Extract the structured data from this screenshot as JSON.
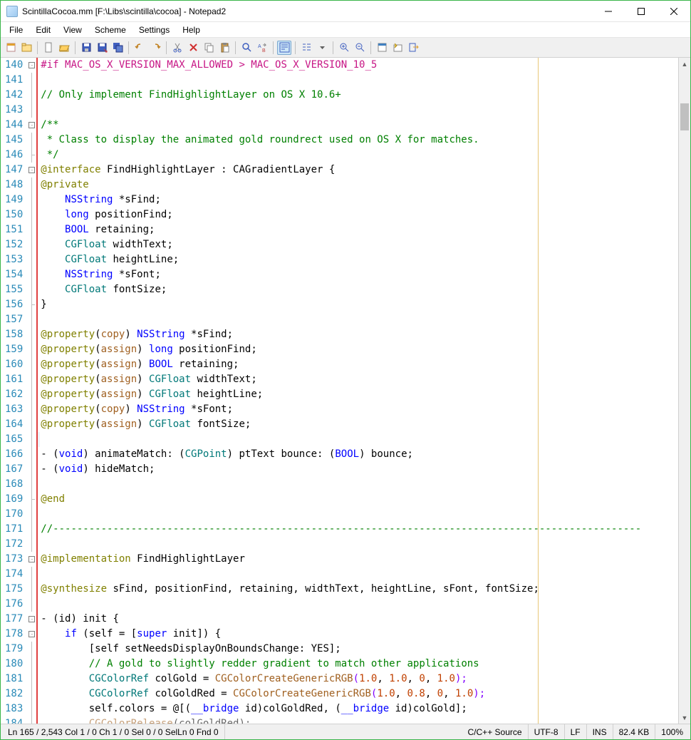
{
  "window": {
    "title": "ScintillaCocoa.mm [F:\\Libs\\scintilla\\cocoa] - Notepad2"
  },
  "menu": [
    "File",
    "Edit",
    "View",
    "Scheme",
    "Settings",
    "Help"
  ],
  "status": {
    "pos": "Ln 165 / 2,543  Col 1 / 0  Ch 1 / 0  Sel 0 / 0  SelLn 0  Fnd 0",
    "lang": "C/C++ Source",
    "enc": "UTF-8",
    "eol": "LF",
    "ovr": "INS",
    "size": "82.4 KB",
    "zoom": "100%"
  },
  "lines": {
    "start": 140,
    "end": 184
  },
  "code": {
    "l140": "#if MAC_OS_X_VERSION_MAX_ALLOWED > MAC_OS_X_VERSION_10_5",
    "l142": "// Only implement FindHighlightLayer on OS X 10.6+",
    "l144": "/**",
    "l145": " * Class to display the animated gold roundrect used on OS X for matches.",
    "l146": " */",
    "l147a": "@interface",
    "l147b": " FindHighlightLayer : CAGradientLayer {",
    "l148": "@private",
    "l149a": "NSString",
    "l149b": " *sFind;",
    "l150a": "long",
    "l150b": " positionFind;",
    "l151a": "BOOL",
    "l151b": " retaining;",
    "l152a": "CGFloat",
    "l152b": " widthText;",
    "l153a": "CGFloat",
    "l153b": " heightLine;",
    "l154a": "NSString",
    "l154b": " *sFont;",
    "l155a": "CGFloat",
    "l155b": " fontSize;",
    "l156": "}",
    "prop": "@property",
    "copy": "copy",
    "assign": "assign",
    "l158t": "NSString",
    "l158r": " *sFind;",
    "l159t": "long",
    "l159r": " positionFind;",
    "l160t": "BOOL",
    "l160r": " retaining;",
    "l161t": "CGFloat",
    "l161r": " widthText;",
    "l162t": "CGFloat",
    "l162r": " heightLine;",
    "l163t": "NSString",
    "l163r": " *sFont;",
    "l164t": "CGFloat",
    "l164r": " fontSize;",
    "l166a": "- (",
    "l166b": "void",
    "l166c": ") animateMatch: (",
    "l166d": "CGPoint",
    "l166e": ") ptText bounce: (",
    "l166f": "BOOL",
    "l166g": ") bounce;",
    "l167a": "- (",
    "l167b": "void",
    "l167c": ") hideMatch;",
    "l169": "@end",
    "l171": "//--------------------------------------------------------------------------------------------------",
    "l173a": "@implementation",
    "l173b": " FindHighlightLayer",
    "l175a": "@synthesize",
    "l175b": " sFind, positionFind, retaining, widthText, heightLine, sFont, fontSize;",
    "l177a": "- (id) init {",
    "l178a": "if",
    "l178b": " (self = [",
    "l178c": "super",
    "l178d": " init]) {",
    "l179": "[self setNeedsDisplayOnBoundsChange: YES];",
    "l180": "// A gold to slightly redder gradient to match other applications",
    "l181a": "CGColorRef",
    "l181b": " colGold = ",
    "l181c": "CGColorCreateGenericRGB",
    "l181d": "(",
    "l181e": "1.0",
    "l181f": ", ",
    "l181g": "1.0",
    "l181h": ", ",
    "l181i": "0",
    "l181j": ", ",
    "l181k": "1.0",
    "l181l": ");",
    "l182a": "CGColorRef",
    "l182b": " colGoldRed = ",
    "l182c": "CGColorCreateGenericRGB",
    "l182d": "(",
    "l182e": "1.0",
    "l182f": ", ",
    "l182g": "0.8",
    "l182h": ", ",
    "l182i": "0",
    "l182j": ", ",
    "l182k": "1.0",
    "l182l": ");",
    "l183a": "self.colors = @[(",
    "l183b": "__bridge",
    "l183c": " id)colGoldRed, (",
    "l183d": "__bridge",
    "l183e": " id)colGold];",
    "l184a": "CGColorRelease",
    "l184b": "(colGoldRed);"
  }
}
